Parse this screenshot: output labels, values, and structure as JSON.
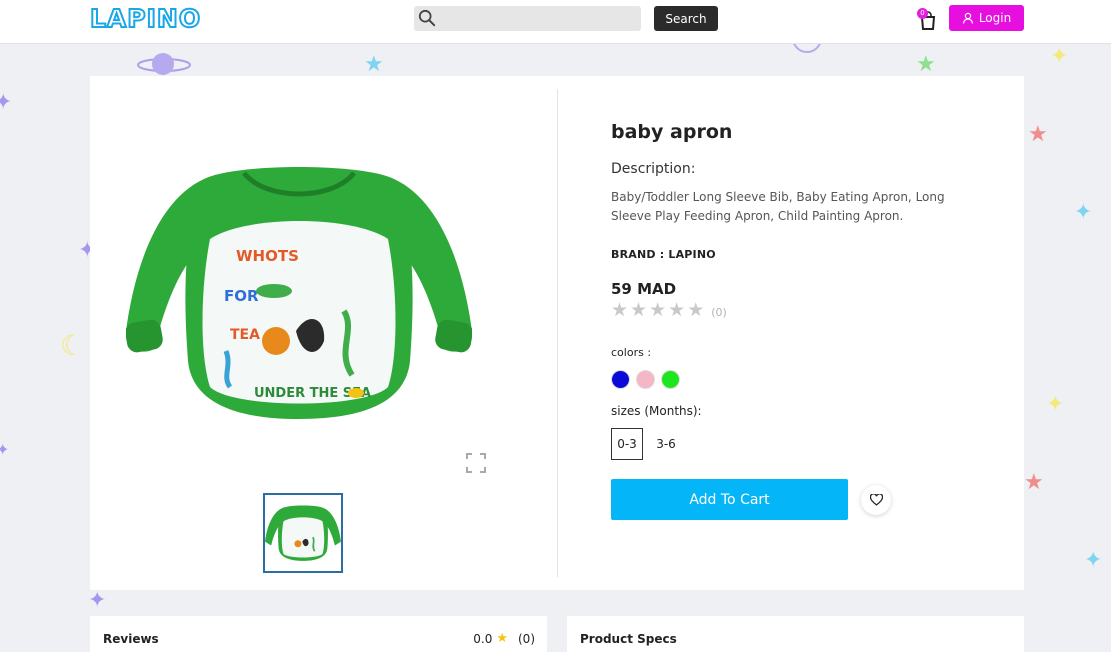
{
  "header": {
    "logo_text": "LAPINO",
    "search_placeholder": "",
    "search_button": "Search",
    "cart_count": "0",
    "login_label": "Login"
  },
  "product": {
    "title": "baby apron",
    "description_label": "Description:",
    "description": "Baby/Toddler Long Sleeve Bib, Baby Eating Apron, Long Sleeve Play Feeding Apron, Child Painting Apron.",
    "brand": "BRAND : LAPINO",
    "price": "59 MAD",
    "rating_stars": 0,
    "rating_count": "(0)",
    "colors_label": "colors :",
    "colors": [
      "#0b0bd9",
      "#f6b6c6",
      "#1ee61e"
    ],
    "sizes_label": "sizes (Months):",
    "sizes": [
      "0-3",
      "3-6"
    ],
    "selected_size": "0-3",
    "add_to_cart": "Add To Cart"
  },
  "reviews": {
    "title": "Reviews",
    "score": "0.0",
    "count": "(0)"
  },
  "specs": {
    "title": "Product Specs"
  },
  "colors": {
    "accent": "#04b6f7",
    "login": "#e60fe0",
    "logo": "#1aa7e8",
    "apron": "#2eaa3a"
  },
  "icons": [
    "search-icon",
    "cart-icon",
    "user-icon",
    "expand-icon",
    "heart-icon",
    "star-icon"
  ]
}
